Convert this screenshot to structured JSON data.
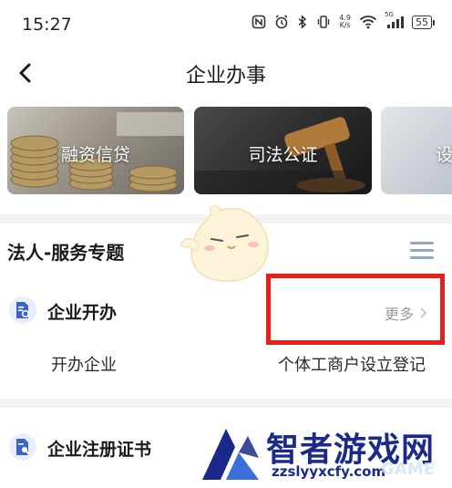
{
  "status_bar": {
    "time": "15:27",
    "net_speed_value": "4.9",
    "net_speed_unit": "K/s",
    "signal_label": "5G",
    "battery": "55"
  },
  "header": {
    "title": "企业办事",
    "back_icon": "chevron-left-icon"
  },
  "banners": [
    {
      "label": "融资信贷"
    },
    {
      "label": "司法公证"
    },
    {
      "label": "设"
    }
  ],
  "service_section": {
    "title": "法人-服务专题",
    "menu_icon": "list-menu-icon",
    "categories": [
      {
        "label": "企业开办",
        "more_label": "更多",
        "items": [
          "开办企业",
          "个体工商户设立登记"
        ]
      },
      {
        "label": "企业注册证书"
      }
    ]
  },
  "watermark": {
    "brand": "智者游戏网",
    "url": "zzslyyxcfy.com",
    "sub": "GAME"
  },
  "colors": {
    "highlight": "#e8201c",
    "accent_blue": "#3a64c8",
    "brand_navy": "#1b2a8a"
  }
}
